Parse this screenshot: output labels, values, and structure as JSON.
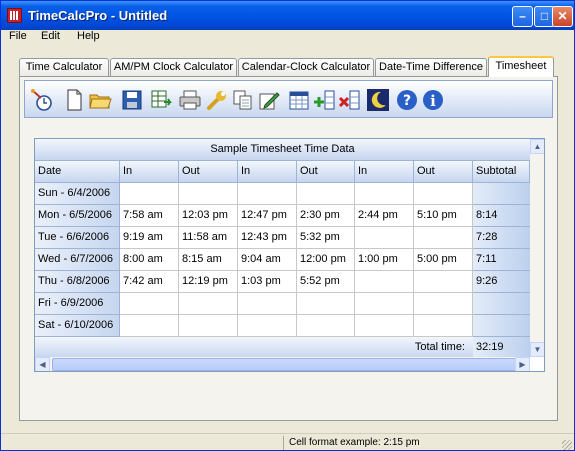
{
  "window": {
    "title": "TimeCalcPro - Untitled",
    "minimize": "–",
    "maximize": "□",
    "close": "✕"
  },
  "menu": [
    "File",
    "Edit",
    "Help"
  ],
  "tabs": [
    {
      "label": "Time Calculator",
      "active": false
    },
    {
      "label": "AM/PM Clock Calculator",
      "active": false
    },
    {
      "label": "Calendar-Clock Calculator",
      "active": false
    },
    {
      "label": "Date-Time Difference",
      "active": false
    },
    {
      "label": "Timesheet",
      "active": true
    }
  ],
  "toolbar": [
    {
      "name": "clock-wizard-icon"
    },
    {
      "name": "new-document-icon"
    },
    {
      "name": "open-folder-icon"
    },
    {
      "name": "save-disk-icon"
    },
    {
      "name": "export-table-icon"
    },
    {
      "name": "printer-icon"
    },
    {
      "name": "wrench-icon"
    },
    {
      "name": "copy-icon"
    },
    {
      "name": "edit-pencil-icon"
    },
    {
      "name": "calendar-grid-icon"
    },
    {
      "name": "add-column-icon"
    },
    {
      "name": "delete-column-icon"
    },
    {
      "name": "night-mode-icon"
    },
    {
      "name": "help-icon"
    },
    {
      "name": "info-icon"
    }
  ],
  "sheet": {
    "title": "Sample Timesheet Time Data",
    "headers": [
      "Date",
      "In",
      "Out",
      "In",
      "Out",
      "In",
      "Out",
      "Subtotal"
    ],
    "rows": [
      [
        "Sun - 6/4/2006",
        "",
        "",
        "",
        "",
        "",
        "",
        ""
      ],
      [
        "Mon - 6/5/2006",
        "7:58 am",
        "12:03 pm",
        "12:47 pm",
        "2:30 pm",
        "2:44 pm",
        "5:10 pm",
        "8:14"
      ],
      [
        "Tue - 6/6/2006",
        "9:19 am",
        "11:58 am",
        "12:43 pm",
        "5:32 pm",
        "",
        "",
        "7:28"
      ],
      [
        "Wed - 6/7/2006",
        "8:00 am",
        "8:15 am",
        "9:04 am",
        "12:00 pm",
        "1:00 pm",
        "5:00 pm",
        "7:11"
      ],
      [
        "Thu - 6/8/2006",
        "7:42 am",
        "12:19 pm",
        "1:03 pm",
        "5:52 pm",
        "",
        "",
        "9:26"
      ],
      [
        "Fri - 6/9/2006",
        "",
        "",
        "",
        "",
        "",
        "",
        ""
      ],
      [
        "Sat - 6/10/2006",
        "",
        "",
        "",
        "",
        "",
        "",
        ""
      ]
    ],
    "total_label": "Total time:",
    "total_value": "32:19"
  },
  "status": {
    "text": "Cell format example: 2:15 pm"
  }
}
